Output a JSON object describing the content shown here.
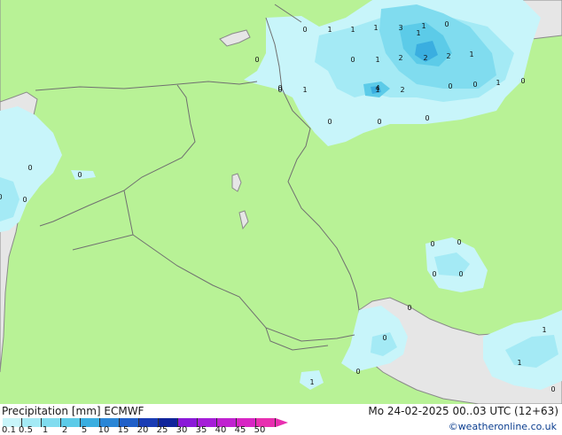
{
  "legend": {
    "title_left": "Precipitation [mm] ECMWF",
    "title_right": "Mo 24-02-2025 00..03 UTC (12+63)",
    "credit": "©weatheronline.co.uk",
    "scale": [
      {
        "label": "0.1",
        "color": "#c8f5fa"
      },
      {
        "label": "0.5",
        "color": "#a4eaf5"
      },
      {
        "label": "1",
        "color": "#80dcef"
      },
      {
        "label": "2",
        "color": "#5ccbe8"
      },
      {
        "label": "5",
        "color": "#3aaee0"
      },
      {
        "label": "10",
        "color": "#2a86d6"
      },
      {
        "label": "15",
        "color": "#2060c8"
      },
      {
        "label": "20",
        "color": "#1a3cb4"
      },
      {
        "label": "25",
        "color": "#10249a"
      },
      {
        "label": "30",
        "color": "#8a1ad8"
      },
      {
        "label": "35",
        "color": "#a51ed8"
      },
      {
        "label": "40",
        "color": "#c022d0"
      },
      {
        "label": "45",
        "color": "#d826c4"
      },
      {
        "label": "50",
        "color": "#e830b0"
      }
    ]
  },
  "map_colors": {
    "land": "#b8f296",
    "sea": "#e6e6e6",
    "border": "#707070",
    "coast": "#8a8a8a"
  },
  "precip_labels": [
    "0",
    "1",
    "1",
    "1",
    "3",
    "1",
    "0",
    "0",
    "0",
    "1",
    "2",
    "2",
    "2",
    "1",
    "0",
    "1",
    "1",
    "2",
    "0",
    "0",
    "4",
    "1",
    "0",
    "0",
    "0",
    "0",
    "0",
    "0",
    "0",
    "0",
    "0",
    "0",
    "0",
    "0",
    "0",
    "0",
    "1",
    "1",
    "0",
    "0",
    "1",
    "1",
    "0"
  ]
}
